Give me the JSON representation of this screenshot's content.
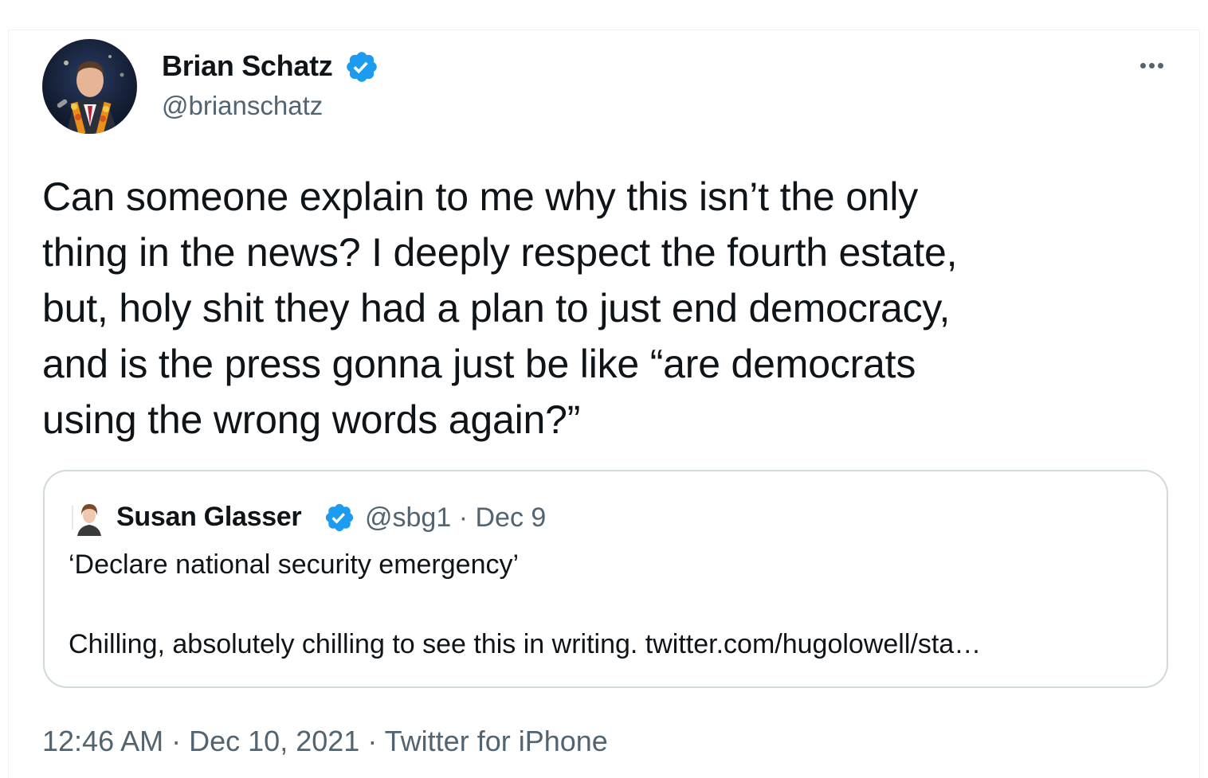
{
  "author": {
    "display_name": "Brian Schatz",
    "handle": "@brianschatz",
    "verified_icon": "verified-badge-icon",
    "avatar_icon": "profile-photo"
  },
  "tweet": {
    "lines": [
      "Can someone explain to me why this isn’t the only",
      "thing in the news? I deeply respect the fourth estate,",
      "but, holy shit they had a plan to just end democracy,",
      "and is the press gonna just be like “are democrats",
      "using the wrong words again?”"
    ]
  },
  "quoted_tweet": {
    "display_name": "Susan Glasser",
    "handle": "@sbg1",
    "separator": "·",
    "date": "Dec 9",
    "line1": "‘Declare national security emergency’",
    "line2": "Chilling, absolutely chilling to see this in writing. twitter.com/hugolowell/sta…"
  },
  "meta": {
    "time": "12:46 AM",
    "separator": "·",
    "date": "Dec 10, 2021",
    "source": "Twitter for iPhone"
  },
  "colors": {
    "text": "#0f1419",
    "secondary": "#536471",
    "verified": "#1d9bf0",
    "border": "#cfd9de"
  }
}
